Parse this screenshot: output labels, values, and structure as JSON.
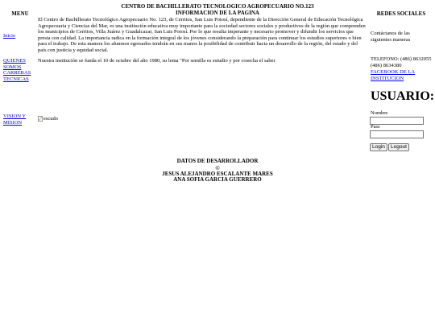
{
  "header": {
    "school_name": "CENTRO DE BACHILLERATO TECNOLOGICO AGROPECUARIO NO.123",
    "page_info": "INFORMACION DE LA PAGINA"
  },
  "menu": {
    "title": "MENU",
    "items": [
      {
        "label": "Inicio"
      },
      {
        "label": "QUIENES SOMOS"
      },
      {
        "label": "CARRERAS TECNICAS"
      },
      {
        "label": "VISION Y MISION"
      }
    ]
  },
  "content": {
    "intro_paragraph": "El Centro de Bachillerato Tecnológico Agropecuario No. 123, de Cerritos, San Luis Potosí, dependiente de la Dirección General de Educación Tecnológica Agropecuaria y Ciencias del Mar, es una institución educativa muy importante para la sociedad sectores sociales y productivos de la región que comprenden los municipios de Cerritos, Villa Juárez y Guadalcazar, San Luis Potosí. Por lo que resulta imperante y necesario promover y difundir los servicios que presta con calidad. La importancia radica en la formación integral de los jóvenes considerando la preparación para continuar los estudios superiores o bien para el trabajo. De esta manera los alumnos egresados tendrán en sus manos la posibilidad de contribuir hacia un desarrollo de la región, del estado y del país con justicia y equidad social.",
    "founded_text": "Nuestra institución se funda el 10 de octubre del año 1980, su lema \"Por semilla es estudio y por cosecha el saber",
    "image_alt": "escudo"
  },
  "social": {
    "title": "REDES SOCIALES",
    "contact_text": "Contáctanos de las siguientes maneras",
    "phone_text": "TELEFONO: (486) 8632055 (486) 8634380",
    "facebook_label": "FACEBOOK DE LA INSTITUCION"
  },
  "login": {
    "title": "USUARIO:",
    "name_label": "Nombre",
    "name_value": "",
    "pass_label": "Pass",
    "pass_value": "",
    "login_button": "Login",
    "logout_button": "Logout"
  },
  "footer": {
    "title": "DATOS DE DESARROLLADOR",
    "copyright": "©",
    "developer_1": "JESUS ALEJANDRO ESCALANTE MARES",
    "developer_2": "ANA SOFIA GARCIA GUERRERO"
  }
}
